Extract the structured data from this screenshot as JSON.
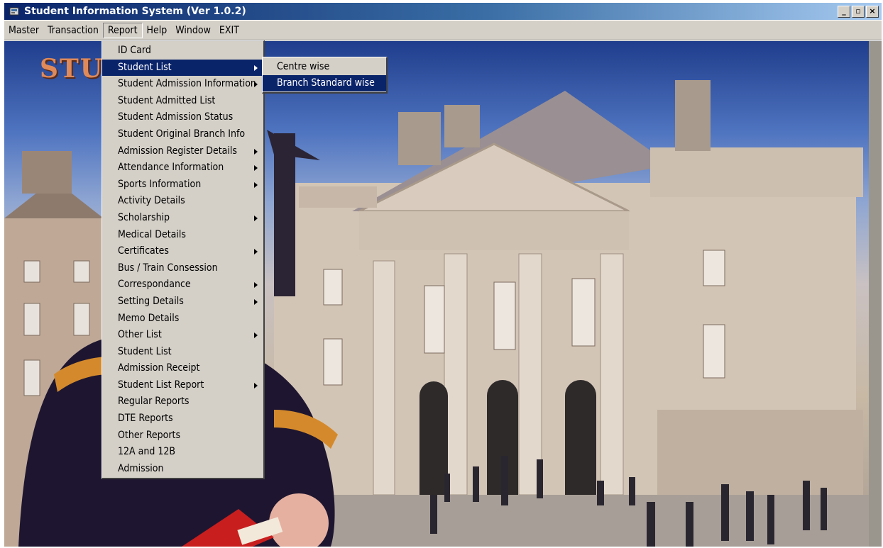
{
  "window": {
    "title": "Student Information System (Ver 1.0.2)",
    "controls": {
      "minimize": "_",
      "restore": "▫",
      "close": "×"
    }
  },
  "menubar": {
    "items": [
      {
        "label": "Master"
      },
      {
        "label": "Transaction"
      },
      {
        "label": "Report",
        "active": true
      },
      {
        "label": "Help"
      },
      {
        "label": "Window"
      },
      {
        "label": "EXIT"
      }
    ]
  },
  "background": {
    "brand_text": "STU"
  },
  "report_menu": {
    "items": [
      {
        "label": "ID Card",
        "submenu": false
      },
      {
        "label": "Student List",
        "submenu": true,
        "highlighted": true
      },
      {
        "label": "Student Admission Information",
        "submenu": true
      },
      {
        "label": "Student Admitted List",
        "submenu": false
      },
      {
        "label": "Student Admission Status",
        "submenu": false
      },
      {
        "label": "Student Original Branch Info",
        "submenu": false
      },
      {
        "label": "Admission Register Details",
        "submenu": true
      },
      {
        "label": "Attendance Information",
        "submenu": true
      },
      {
        "label": "Sports Information",
        "submenu": true
      },
      {
        "label": "Activity Details",
        "submenu": false
      },
      {
        "label": "Scholarship",
        "submenu": true
      },
      {
        "label": "Medical Details",
        "submenu": false
      },
      {
        "label": "Certificates",
        "submenu": true
      },
      {
        "label": "Bus / Train Consession",
        "submenu": false
      },
      {
        "label": "Correspondance",
        "submenu": true
      },
      {
        "label": "Setting Details",
        "submenu": true
      },
      {
        "label": "Memo Details",
        "submenu": false
      },
      {
        "label": "Other List",
        "submenu": true
      },
      {
        "label": "Student List",
        "submenu": false
      },
      {
        "label": "Admission Receipt",
        "submenu": false
      },
      {
        "label": "Student List Report",
        "submenu": true
      },
      {
        "label": "Regular Reports",
        "submenu": false
      },
      {
        "label": "DTE Reports",
        "submenu": false
      },
      {
        "label": "Other Reports",
        "submenu": false
      },
      {
        "label": "12A and 12B",
        "submenu": false
      },
      {
        "label": "Admission",
        "submenu": false
      }
    ]
  },
  "student_list_submenu": {
    "items": [
      {
        "label": "Centre wise",
        "highlighted": false
      },
      {
        "label": "Branch Standard wise",
        "highlighted": true
      }
    ]
  },
  "colors": {
    "menu_face": "#d4d0c8",
    "highlight": "#0a246a",
    "brand_text": "#e08a5a"
  }
}
